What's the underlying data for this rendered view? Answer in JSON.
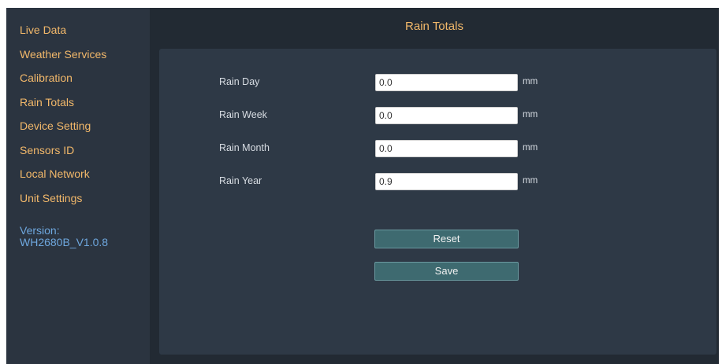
{
  "sidebar": {
    "items": [
      {
        "label": "Live Data"
      },
      {
        "label": "Weather Services"
      },
      {
        "label": "Calibration"
      },
      {
        "label": "Rain Totals"
      },
      {
        "label": "Device Setting"
      },
      {
        "label": "Sensors ID"
      },
      {
        "label": "Local Network"
      },
      {
        "label": "Unit Settings"
      }
    ],
    "version_label": "Version:",
    "version_value": "WH2680B_V1.0.8"
  },
  "main": {
    "title": "Rain Totals",
    "rows": [
      {
        "label": "Rain Day",
        "value": "0.0",
        "unit": "mm"
      },
      {
        "label": "Rain Week",
        "value": "0.0",
        "unit": "mm"
      },
      {
        "label": "Rain Month",
        "value": "0.0",
        "unit": "mm"
      },
      {
        "label": "Rain Year",
        "value": "0.9",
        "unit": "mm"
      }
    ],
    "reset_label": "Reset",
    "save_label": "Save"
  },
  "colors": {
    "sidebar_bg": "#2b3440",
    "main_bg": "#222a33",
    "panel_bg": "#2e3946",
    "nav_text": "#f2b86a",
    "version_text": "#6ea7de",
    "button_bg": "#3e6a70"
  }
}
